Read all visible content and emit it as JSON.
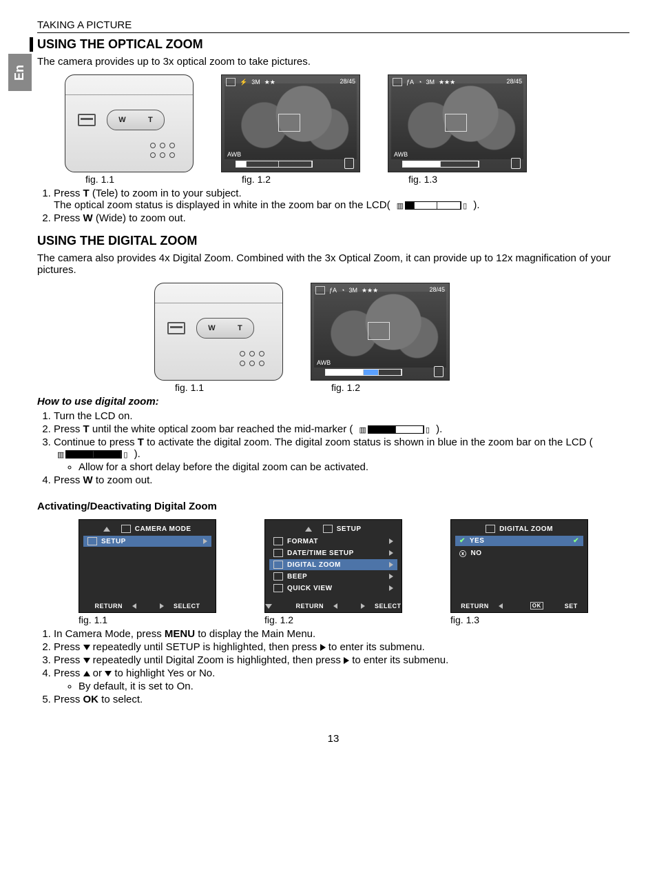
{
  "lang_tab": "En",
  "header": "TAKING A PICTURE",
  "s1_title": "USING THE OPTICAL ZOOM",
  "s1_intro": "The camera provides up to 3x optical zoom to take pictures.",
  "camera_btn_w": "W",
  "camera_btn_t": "T",
  "fig11": "fig. 1.1",
  "fig12": "fig. 1.2",
  "fig13": "fig. 1.3",
  "lcd": {
    "stars2": "★★",
    "stars3": "★★★",
    "q": "3M",
    "awb": "AWB",
    "counter": "28/45",
    "fa": "ƒA"
  },
  "s1_steps": {
    "1a": "Press ",
    "1b": "T",
    "1c": " (Tele) to zoom in to your subject.",
    "1line2a": "The optical zoom status is displayed in white in the zoom bar on the LCD(",
    "1line2b": " ).",
    "2a": "Press ",
    "2b": "W",
    "2c": " (Wide) to zoom out."
  },
  "s2_title": "USING THE DIGITAL ZOOM",
  "s2_intro": "The camera also provides 4x Digital Zoom. Combined with the 3x Optical Zoom, it can provide up to 12x magnification of your pictures.",
  "howto_title": "How to use digital zoom:",
  "howto": {
    "1": "Turn the LCD on.",
    "2a": "Press ",
    "2b": "T",
    "2c": " until the white optical zoom bar reached the mid-marker (",
    "2d": " ).",
    "3a": "Continue to press ",
    "3b": "T",
    "3c": " to activate the digital zoom. The digital zoom status is shown in blue in the zoom bar on the LCD (",
    "3d": ").",
    "3bullet": "Allow for a short delay before the digital zoom can be activated.",
    "4a": "Press ",
    "4b": "W",
    "4c": " to zoom out."
  },
  "act_title": "Activating/Deactivating Digital Zoom",
  "menu1": {
    "title": "CAMERA MODE",
    "item": "SETUP",
    "return": "RETURN",
    "select": "SELECT"
  },
  "menu2": {
    "title": "SETUP",
    "i1": "FORMAT",
    "i2": "DATE/TIME SETUP",
    "i3": "DIGITAL ZOOM",
    "i4": "BEEP",
    "i5": "QUICK VIEW",
    "return": "RETURN",
    "select": "SELECT"
  },
  "menu3": {
    "title": "DIGITAL  ZOOM",
    "yes": "YES",
    "no": "NO",
    "return": "RETURN",
    "ok": "OK",
    "set": "SET"
  },
  "act_steps": {
    "1a": "In Camera Mode, press ",
    "1b": "MENU",
    "1c": " to display the Main Menu.",
    "2a": "Press ",
    "2b": " repeatedly until SETUP is highlighted, then press ",
    "2c": " to enter its submenu.",
    "3a": "Press ",
    "3b": " repeatedly until Digital Zoom is highlighted, then press ",
    "3c": " to enter its submenu.",
    "4a": "Press ",
    "4b": " or ",
    "4c": " to highlight Yes or No.",
    "4bullet": "By default, it is set to On.",
    "5a": "Press ",
    "5b": "OK",
    "5c": " to select."
  },
  "page_number": "13"
}
